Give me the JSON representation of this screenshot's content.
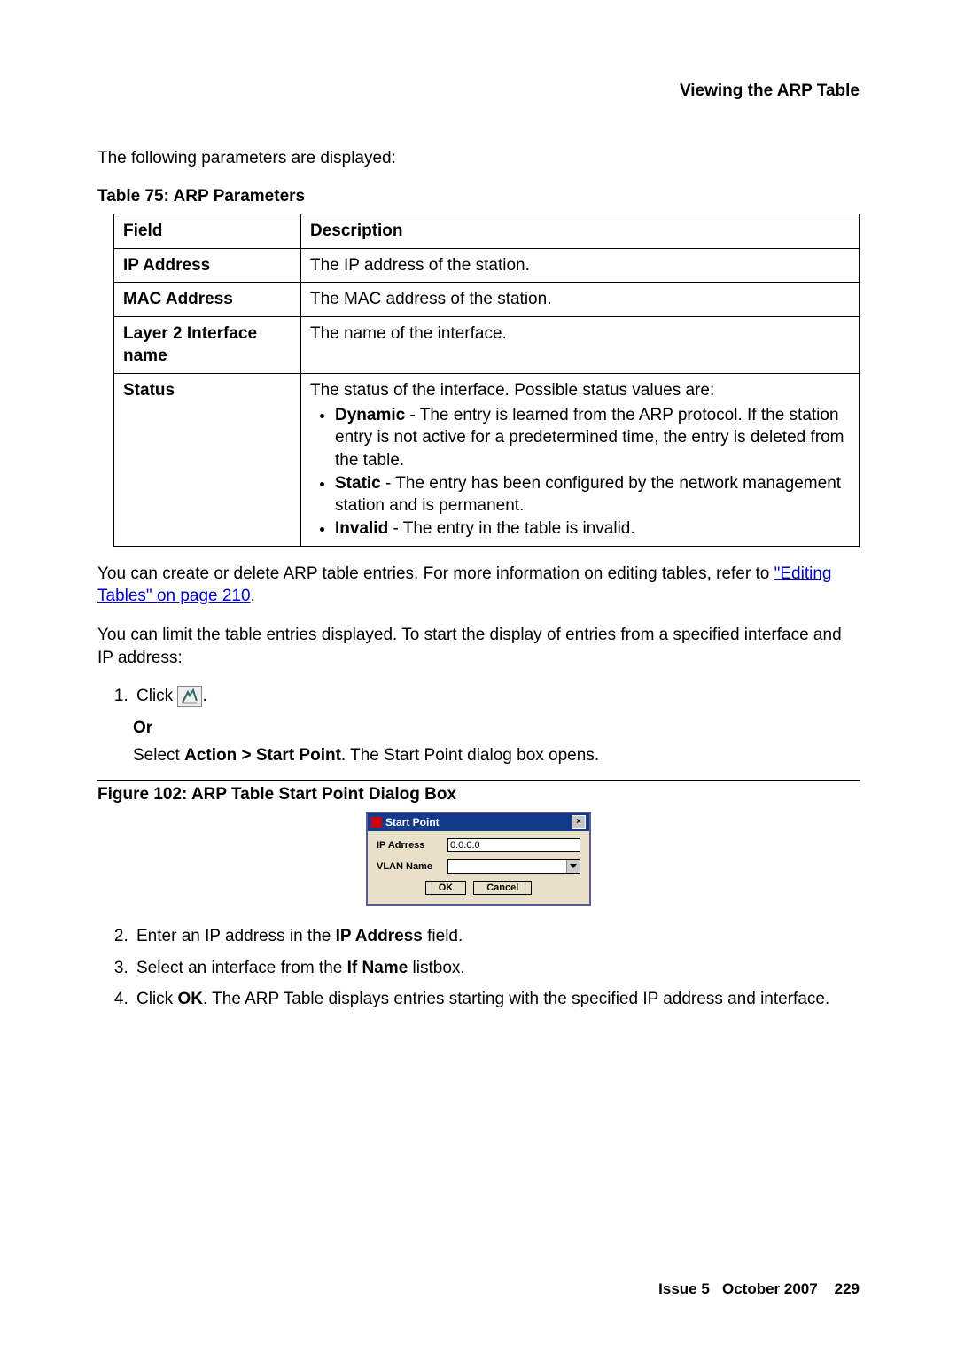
{
  "header": {
    "section_title": "Viewing the ARP Table"
  },
  "intro": "The following parameters are displayed:",
  "table_caption": "Table 75: ARP Parameters",
  "table": {
    "headers": {
      "field": "Field",
      "description": "Description"
    },
    "rows": [
      {
        "field": "IP Address",
        "description": "The IP address of the station."
      },
      {
        "field": "MAC Address",
        "description": "The MAC address of the station."
      },
      {
        "field": "Layer 2 Interface name",
        "description": "The name of the interface."
      }
    ],
    "status_row": {
      "field": "Status",
      "intro": "The status of the interface. Possible status values are:",
      "items": {
        "dynamic_label": "Dynamic",
        "dynamic_desc": " - The entry is learned from the ARP protocol. If the station entry is not active for a predetermined time, the entry is deleted from the table.",
        "static_label": "Static",
        "static_desc": " - The entry has been configured by the network management station and is permanent.",
        "invalid_label": "Invalid",
        "invalid_desc": " - The entry in the table is invalid."
      }
    }
  },
  "after_table": {
    "p1_pre": "You can create or delete ARP table entries. For more information on editing tables, refer to ",
    "p1_link": "\"Editing Tables\" on page 210",
    "p1_post": ".",
    "p2": "You can limit the table entries displayed. To start the display of entries from a specified interface and IP address:"
  },
  "steps": {
    "s1": "Click ",
    "s1_post": ".",
    "or": "Or",
    "s1b_pre": "Select ",
    "s1b_bold": "Action > Start Point",
    "s1b_post": ". The Start Point dialog box opens.",
    "figure_caption": "Figure 102: ARP Table Start Point Dialog Box",
    "s2_pre": "Enter an IP address in the ",
    "s2_bold": "IP Address",
    "s2_post": " field.",
    "s3_pre": "Select an interface from the ",
    "s3_bold": "If Name",
    "s3_post": " listbox.",
    "s4_pre": "Click ",
    "s4_bold": "OK",
    "s4_post": ". The ARP Table displays entries starting with the specified IP address and interface."
  },
  "dialog": {
    "title": "Start Point",
    "ip_label": "IP Adrress",
    "ip_value": "0.0.0.0",
    "vlan_label": "VLAN Name",
    "ok": "OK",
    "cancel": "Cancel"
  },
  "footer": {
    "issue": "Issue 5",
    "month": "October 2007",
    "page": "229"
  }
}
